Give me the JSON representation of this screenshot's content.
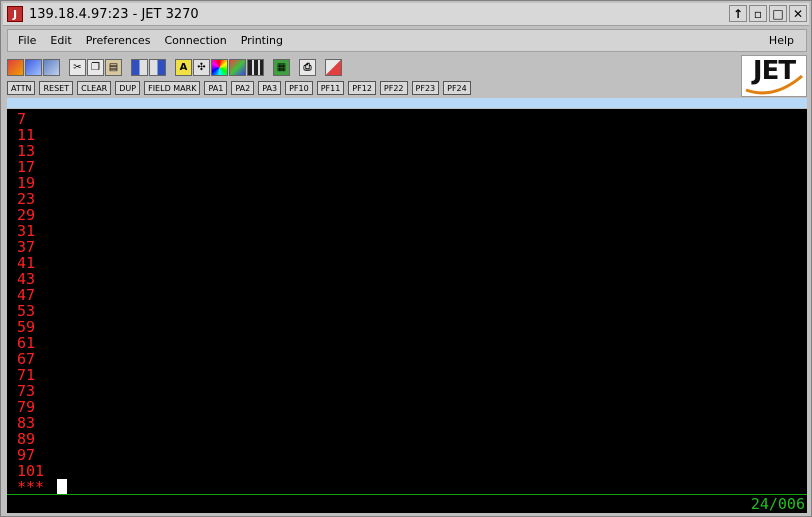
{
  "window": {
    "title": "139.18.4.97:23 - JET 3270",
    "icon_letter": "J",
    "controls": [
      "↑",
      "▫",
      "□",
      "✕"
    ]
  },
  "menu": {
    "items": [
      "File",
      "Edit",
      "Preferences",
      "Connection",
      "Printing"
    ],
    "help": "Help"
  },
  "toolbar": {
    "icons": [
      "session-icon",
      "copy-screen-icon",
      "paste-screen-icon",
      "cut-icon",
      "copy-icon",
      "paste-icon",
      "grid-a-icon",
      "grid-b-icon",
      "font-icon",
      "keypad-icon",
      "color-icon",
      "palette-icon",
      "layout-icon",
      "macro-icon",
      "print-icon",
      "print-setup-icon"
    ]
  },
  "logo": {
    "text": "JET"
  },
  "keys": [
    "ATTN",
    "RESET",
    "CLEAR",
    "DUP",
    "FIELD MARK",
    "PA1",
    "PA2",
    "PA3",
    "PF10",
    "PF11",
    "PF12",
    "PF22",
    "PF23",
    "PF24"
  ],
  "terminal": {
    "lines": [
      "7",
      "11",
      "13",
      "17",
      "19",
      "23",
      "29",
      "31",
      "37",
      "41",
      "43",
      "47",
      "53",
      "59",
      "61",
      "67",
      "71",
      "73",
      "79",
      "83",
      "89",
      "97",
      "101",
      "***"
    ],
    "status_position": "24/006"
  },
  "colors": {
    "terminal_bg": "#000000",
    "text": "#ff2020",
    "status": "#20c020"
  }
}
